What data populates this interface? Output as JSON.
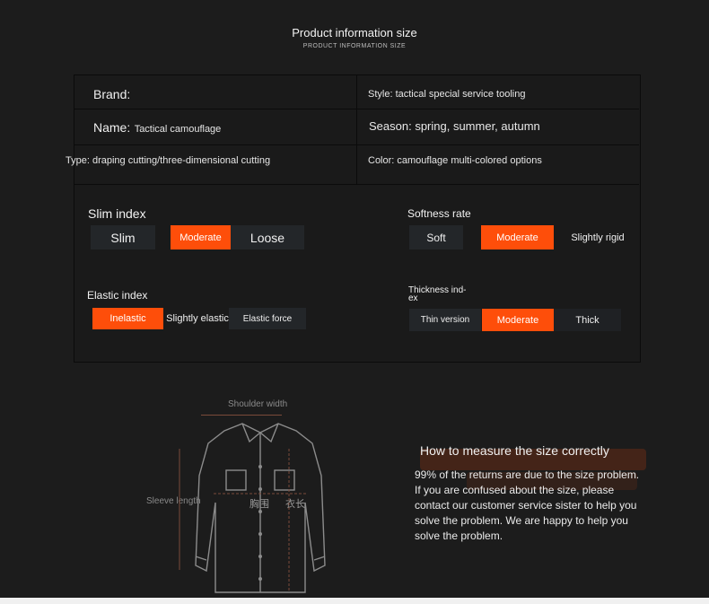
{
  "header": {
    "title": "Product information size",
    "subtitle": "PRODUCT INFORMATION SIZE"
  },
  "info": {
    "brand_label": "Brand:",
    "name_label": "Name:",
    "name_value": "Tactical camouflage",
    "type_text": "Type: draping cutting/three-dimensional cutting",
    "style_text": "Style: tactical special service tooling",
    "season_text": "Season: spring, summer, autumn",
    "color_text": "Color: camouflage multi-colored options"
  },
  "indices": {
    "slim": {
      "title": "Slim index",
      "options": [
        "Slim",
        "Moderate",
        "Loose"
      ],
      "selected": "Moderate"
    },
    "softness": {
      "title": "Softness rate",
      "options": [
        "Soft",
        "Moderate",
        "Slightly rigid"
      ],
      "selected": "Moderate"
    },
    "elastic": {
      "title": "Elastic index",
      "options": [
        "Inelastic",
        "Slightly elastic",
        "Elastic force"
      ],
      "selected": "Inelastic"
    },
    "thickness": {
      "title": "Thickness ind-\nex",
      "options": [
        "Thin version",
        "Moderate",
        "Thick"
      ],
      "selected": "Moderate"
    }
  },
  "measure": {
    "shoulder": "Shoulder width",
    "sleeve": "Sleeve length",
    "chest": "胸围",
    "length": "衣长"
  },
  "how_to": {
    "title": "How to measure the size correctly",
    "text": "99% of the returns are due to the size problem. If you are confused about the size, please contact our customer service sister to help you solve the problem. We are happy to help you solve the problem."
  },
  "colors": {
    "accent": "#fe4e0a",
    "background": "#1c1c1c"
  }
}
